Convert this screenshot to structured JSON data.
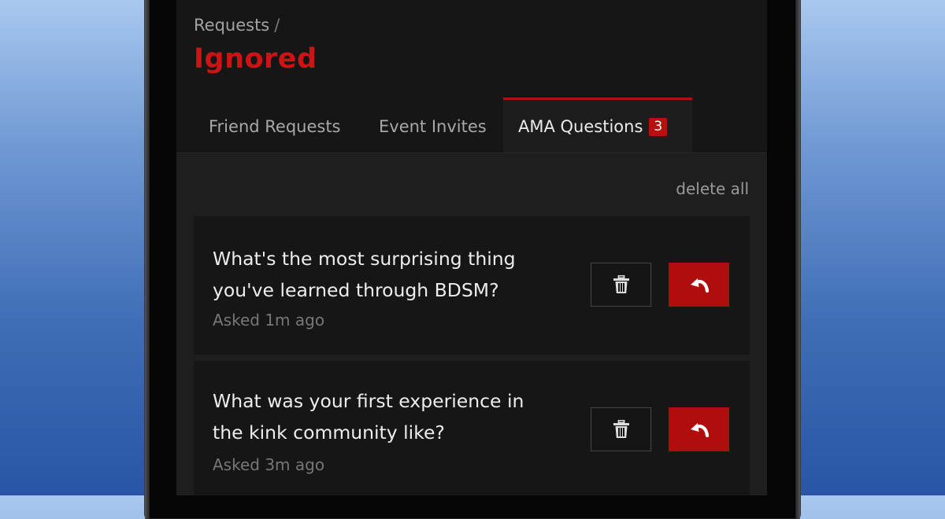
{
  "breadcrumb": {
    "parent": "Requests",
    "separator": "/"
  },
  "page": {
    "title": "Ignored"
  },
  "tabs": [
    {
      "label": "Friend Requests",
      "active": false
    },
    {
      "label": "Event Invites",
      "active": false
    },
    {
      "label": "AMA Questions",
      "active": true,
      "badge": "3"
    }
  ],
  "actions": {
    "delete_all": "delete all"
  },
  "questions": [
    {
      "text": "What's the most surprising thing you've learned through BDSM?",
      "asked": "Asked 1m ago",
      "delete_icon": "trash-icon",
      "restore_icon": "undo-arrow-icon"
    },
    {
      "text": "What was your first experience in the kink community like?",
      "asked": "Asked 3m ago",
      "delete_icon": "trash-icon",
      "restore_icon": "undo-arrow-icon"
    }
  ],
  "colors": {
    "accent": "#cc1414",
    "button_red": "#b00d0d",
    "background": "#161616",
    "panel": "#1e1e1e"
  }
}
